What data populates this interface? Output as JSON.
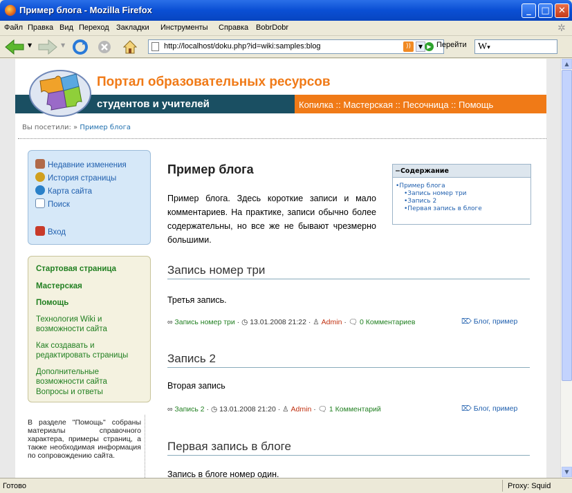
{
  "window": {
    "title": "Пример блога - Mozilla Firefox"
  },
  "menu": [
    "Файл",
    "Правка",
    "Вид",
    "Переход",
    "Закладки",
    "Инструменты",
    "Справка",
    "BobrDobr"
  ],
  "toolbar": {
    "url": "http://localhost/doku.php?id=wiki:samples:blog",
    "go_label": "Перейти",
    "search_engine": "W"
  },
  "site": {
    "title": "Портал образовательных ресурсов",
    "subtitle": "студентов и учителей",
    "topnav": "Копилка :: Мастерская :: Песочница :: Помощь",
    "breadcrumb_prefix": "Вы посетили: »",
    "breadcrumb_link": "Пример блога"
  },
  "tools": [
    {
      "label": "Недавние изменения",
      "icon": "recent-changes-icon"
    },
    {
      "label": "История страницы",
      "icon": "page-history-icon"
    },
    {
      "label": "Карта сайта",
      "icon": "sitemap-icon"
    },
    {
      "label": "Поиск",
      "icon": "search-icon"
    },
    {
      "label": "Вход",
      "icon": "login-icon"
    }
  ],
  "nav": [
    {
      "label": "Стартовая страница"
    },
    {
      "label": "Мастерская"
    },
    {
      "label": "Помощь"
    },
    {
      "label": "Технология Wiki и возможности сайта"
    },
    {
      "label": "Как создавать и редактировать страницы"
    },
    {
      "label": "Дополнительные возможности сайта"
    },
    {
      "label": "Вопросы и ответы"
    }
  ],
  "help_text": "В разделе \"Помощь\" собраны материалы справочного характера, примеры страниц, а также необходимая информация по сопровождению сайта.",
  "main": {
    "title": "Пример блога",
    "intro": "Пример блога. Здесь короткие записи и мало комментариев. На практике, записи обычно более содержательны, но все же не бывают чрезмерно большими.",
    "toc": {
      "header": "−Содержание",
      "items": [
        "•Пример блога",
        "•Запись номер три",
        "•Запись 2",
        "•Первая запись в блоге"
      ]
    },
    "posts": [
      {
        "title": "Запись номер три",
        "text": "Третья запись.",
        "link": "Запись номер три",
        "date": "13.01.2008 21:22",
        "author": "Admin",
        "comments": "0 Комментариев",
        "tags": "Блог, пример"
      },
      {
        "title": "Запись 2",
        "text": "Вторая запись",
        "link": "Запись 2",
        "date": "13.01.2008 21:20",
        "author": "Admin",
        "comments": "1 Комментарий",
        "tags": "Блог, пример"
      },
      {
        "title": "Первая запись в блоге",
        "text": "Запись в блоге номер один."
      }
    ]
  },
  "status": {
    "left": "Готово",
    "right": "Proxy: Squid"
  }
}
